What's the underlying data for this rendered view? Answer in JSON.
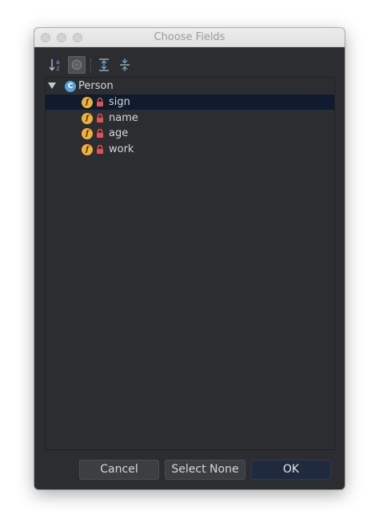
{
  "window": {
    "title": "Choose Fields"
  },
  "toolbar": {
    "sort_icon": "sort-alphabetically-icon",
    "show_classes_icon": "show-classes-icon",
    "expand_icon": "expand-all-icon",
    "collapse_icon": "collapse-all-icon"
  },
  "tree": {
    "root": {
      "label": "Person",
      "badge": "C",
      "expanded": true
    },
    "fields": [
      {
        "label": "sign",
        "badge": "f",
        "selected": true
      },
      {
        "label": "name",
        "badge": "f",
        "selected": false
      },
      {
        "label": "age",
        "badge": "f",
        "selected": false
      },
      {
        "label": "work",
        "badge": "f",
        "selected": false
      }
    ]
  },
  "buttons": {
    "cancel": "Cancel",
    "select_none": "Select None",
    "ok": "OK"
  },
  "colors": {
    "background": "#2b2d30",
    "selection": "#0f1c2d",
    "field_badge": "#efb240",
    "class_badge": "#5a9fd6",
    "lock": "#e05252",
    "primary_button": "#202a3e"
  }
}
